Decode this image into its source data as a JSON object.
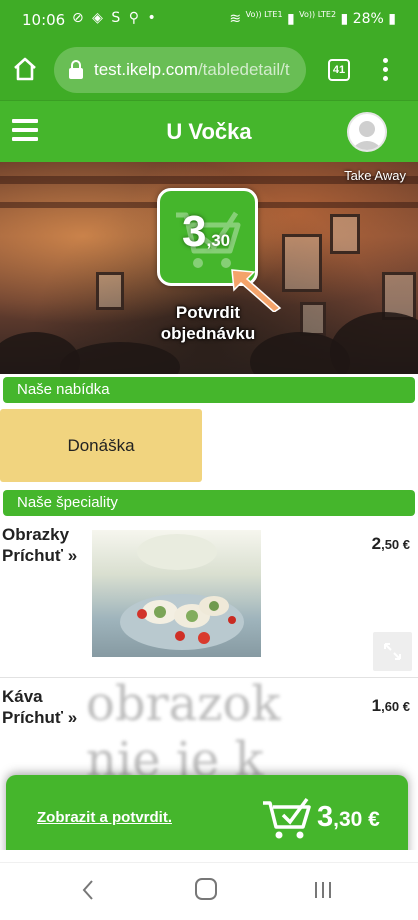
{
  "status_bar": {
    "time": "10:06",
    "icons_left": "⊘ ◈ S ⚲ •",
    "network_1": "Vo)) LTE1",
    "network_2": "Vo)) LTE2",
    "battery": "28%"
  },
  "browser": {
    "url_host": "test.ikelp.com",
    "url_path": "/tabledetail/t",
    "tab_count": "41"
  },
  "header": {
    "title": "U Vočka"
  },
  "hero": {
    "take_away_label": "Take Away",
    "cart_amount_main": "3",
    "cart_amount_cents": ",30",
    "confirm_label": "Potvrdit objednávku"
  },
  "sections": {
    "offer_title": "Naše nabídka",
    "specials_title": "Naše špeciality"
  },
  "offer": {
    "tile_label": "Donáška"
  },
  "products": [
    {
      "name": "Obrazky Príchuť »",
      "price_main": "2",
      "price_cents": ",50 €"
    },
    {
      "name": "Káva Príchuť »",
      "price_main": "1",
      "price_cents": ",60 €"
    }
  ],
  "placeholder_text": "obrazok nie je k",
  "checkout": {
    "link_label": "Zobrazit a potvrdit.",
    "amount_main": "3",
    "amount_cents": ",30 €"
  },
  "colors": {
    "brand_green": "#45b62c",
    "status_green": "#3fac26",
    "offer_tile": "#f1d47f",
    "arrow": "#f4a36a"
  }
}
